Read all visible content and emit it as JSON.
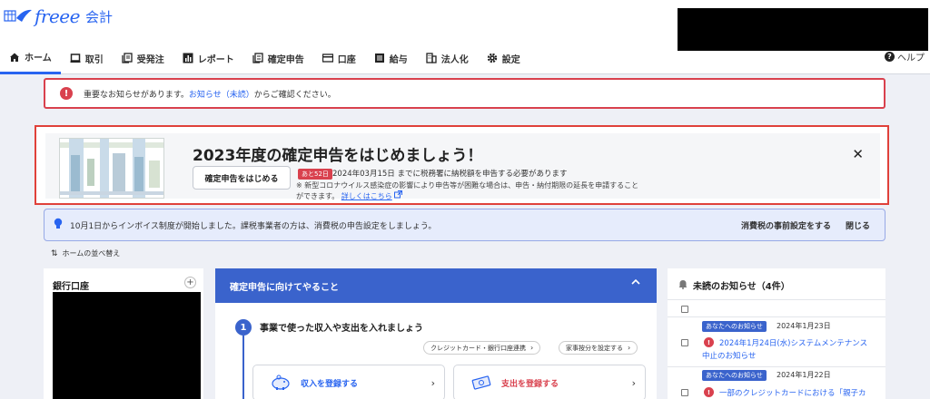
{
  "header": {
    "logo_text": "freee",
    "logo_sub": "会計",
    "help_label": "ヘルプ"
  },
  "nav": [
    {
      "label": "ホーム",
      "icon": "home-icon"
    },
    {
      "label": "取引",
      "icon": "laptop-icon"
    },
    {
      "label": "受発注",
      "icon": "documents-icon"
    },
    {
      "label": "レポート",
      "icon": "bar-chart-icon"
    },
    {
      "label": "確定申告",
      "icon": "form-icon"
    },
    {
      "label": "口座",
      "icon": "card-icon"
    },
    {
      "label": "給与",
      "icon": "list-icon"
    },
    {
      "label": "法人化",
      "icon": "building-icon"
    },
    {
      "label": "設定",
      "icon": "gear-icon"
    }
  ],
  "alert": {
    "prefix": "重要なお知らせがあります。",
    "link": "お知らせ（未読）",
    "suffix": "からご確認ください。"
  },
  "tax_banner": {
    "title": "2023年度の確定申告をはじめましょう！",
    "button": "確定申告をはじめる",
    "days_left": "あと52日",
    "deadline": "2024年03月15日 までに税務署に納税額を申告する必要があります",
    "note_line1": "※ 新型コロナウイルス感染症の影響により申告等が困難な場合は、申告・納付期限の延長を申請すること",
    "note_line2": "ができます。",
    "note_link": "詳しくはこちら",
    "close": "✕"
  },
  "invoice_notice": {
    "text": "10月1日からインボイス制度が開始しました。課税事業者の方は、消費税の申告設定をしましょう。",
    "action": "消費税の事前設定をする",
    "close": "閉じる"
  },
  "reorder_label": "ホームの並べ替え",
  "bank_card": {
    "title": "銀行口座",
    "add": "+"
  },
  "todo": {
    "header": "確定申告に向けてやること",
    "step_number": "1",
    "step_title": "事業で使った収入や支出を入れましょう",
    "pill_card": "クレジットカード・銀行口座連携",
    "pill_ratio": "家事按分を設定する",
    "income_label": "収入を登録する",
    "expense_label": "支出を登録する"
  },
  "news": {
    "title": "未読のお知らせ（4件）",
    "items": [
      {
        "tag": "あなたへのお知らせ",
        "date": "2024年1月23日",
        "line1": "2024年1月24日(水)システムメンテナンス",
        "line2": "中止のお知らせ"
      },
      {
        "tag": "あなたへのお知らせ",
        "date": "2024年1月22日",
        "line1": "一部のクレジットカードにおける「親子カ"
      }
    ]
  },
  "colors": {
    "brand_blue": "#2864f0",
    "header_blue": "#3a63cc",
    "alert_red": "#d9414e"
  }
}
